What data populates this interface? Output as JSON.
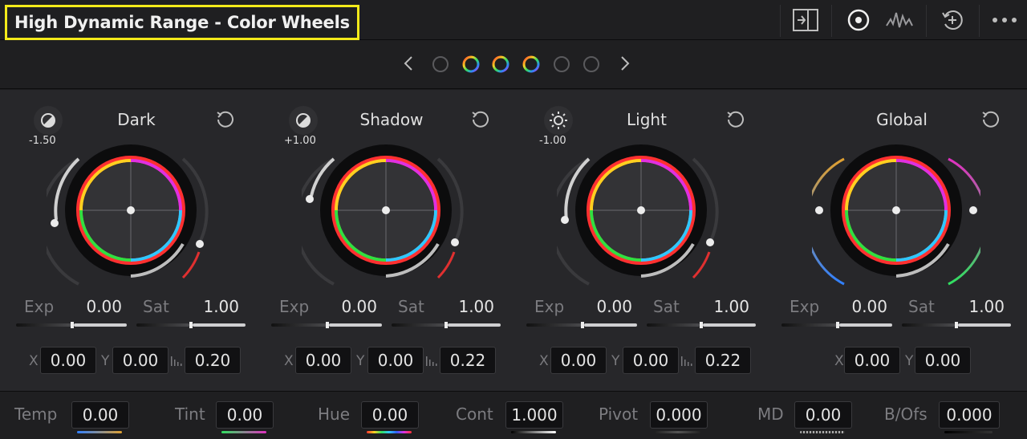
{
  "header": {
    "title": "High Dynamic Range - Color Wheels",
    "icons": [
      "split-view-icon",
      "color-wheel-icon",
      "waveform-icon",
      "add-zone-icon",
      "more-icon"
    ]
  },
  "nav": {
    "prev_icon": "chevron-left-icon",
    "next_icon": "chevron-right-icon",
    "page_count": 6,
    "active_pages": [
      2,
      3,
      4
    ]
  },
  "wheels": [
    {
      "title": "Dark",
      "mode_value": "-1.50",
      "exp_label": "Exp",
      "exp": "0.00",
      "sat_label": "Sat",
      "sat": "1.00",
      "x_label": "X",
      "x": "0.00",
      "y_label": "Y",
      "y": "0.00",
      "falloff": "0.20"
    },
    {
      "title": "Shadow",
      "mode_value": "+1.00",
      "exp_label": "Exp",
      "exp": "0.00",
      "sat_label": "Sat",
      "sat": "1.00",
      "x_label": "X",
      "x": "0.00",
      "y_label": "Y",
      "y": "0.00",
      "falloff": "0.22"
    },
    {
      "title": "Light",
      "mode_value": "-1.00",
      "exp_label": "Exp",
      "exp": "0.00",
      "sat_label": "Sat",
      "sat": "1.00",
      "x_label": "X",
      "x": "0.00",
      "y_label": "Y",
      "y": "0.00",
      "falloff": "0.22"
    },
    {
      "title": "Global",
      "exp_label": "Exp",
      "exp": "0.00",
      "sat_label": "Sat",
      "sat": "1.00",
      "x_label": "X",
      "x": "0.00",
      "y_label": "Y",
      "y": "0.00"
    }
  ],
  "footer": [
    {
      "label": "Temp",
      "value": "0.00"
    },
    {
      "label": "Tint",
      "value": "0.00"
    },
    {
      "label": "Hue",
      "value": "0.00"
    },
    {
      "label": "Cont",
      "value": "1.000"
    },
    {
      "label": "Pivot",
      "value": "0.000"
    },
    {
      "label": "MD",
      "value": "0.00"
    },
    {
      "label": "B/Ofs",
      "value": "0.000"
    }
  ],
  "colors": {
    "highlight": "#f4ea1a",
    "panel": "#27272a",
    "header": "#1f1f21"
  }
}
